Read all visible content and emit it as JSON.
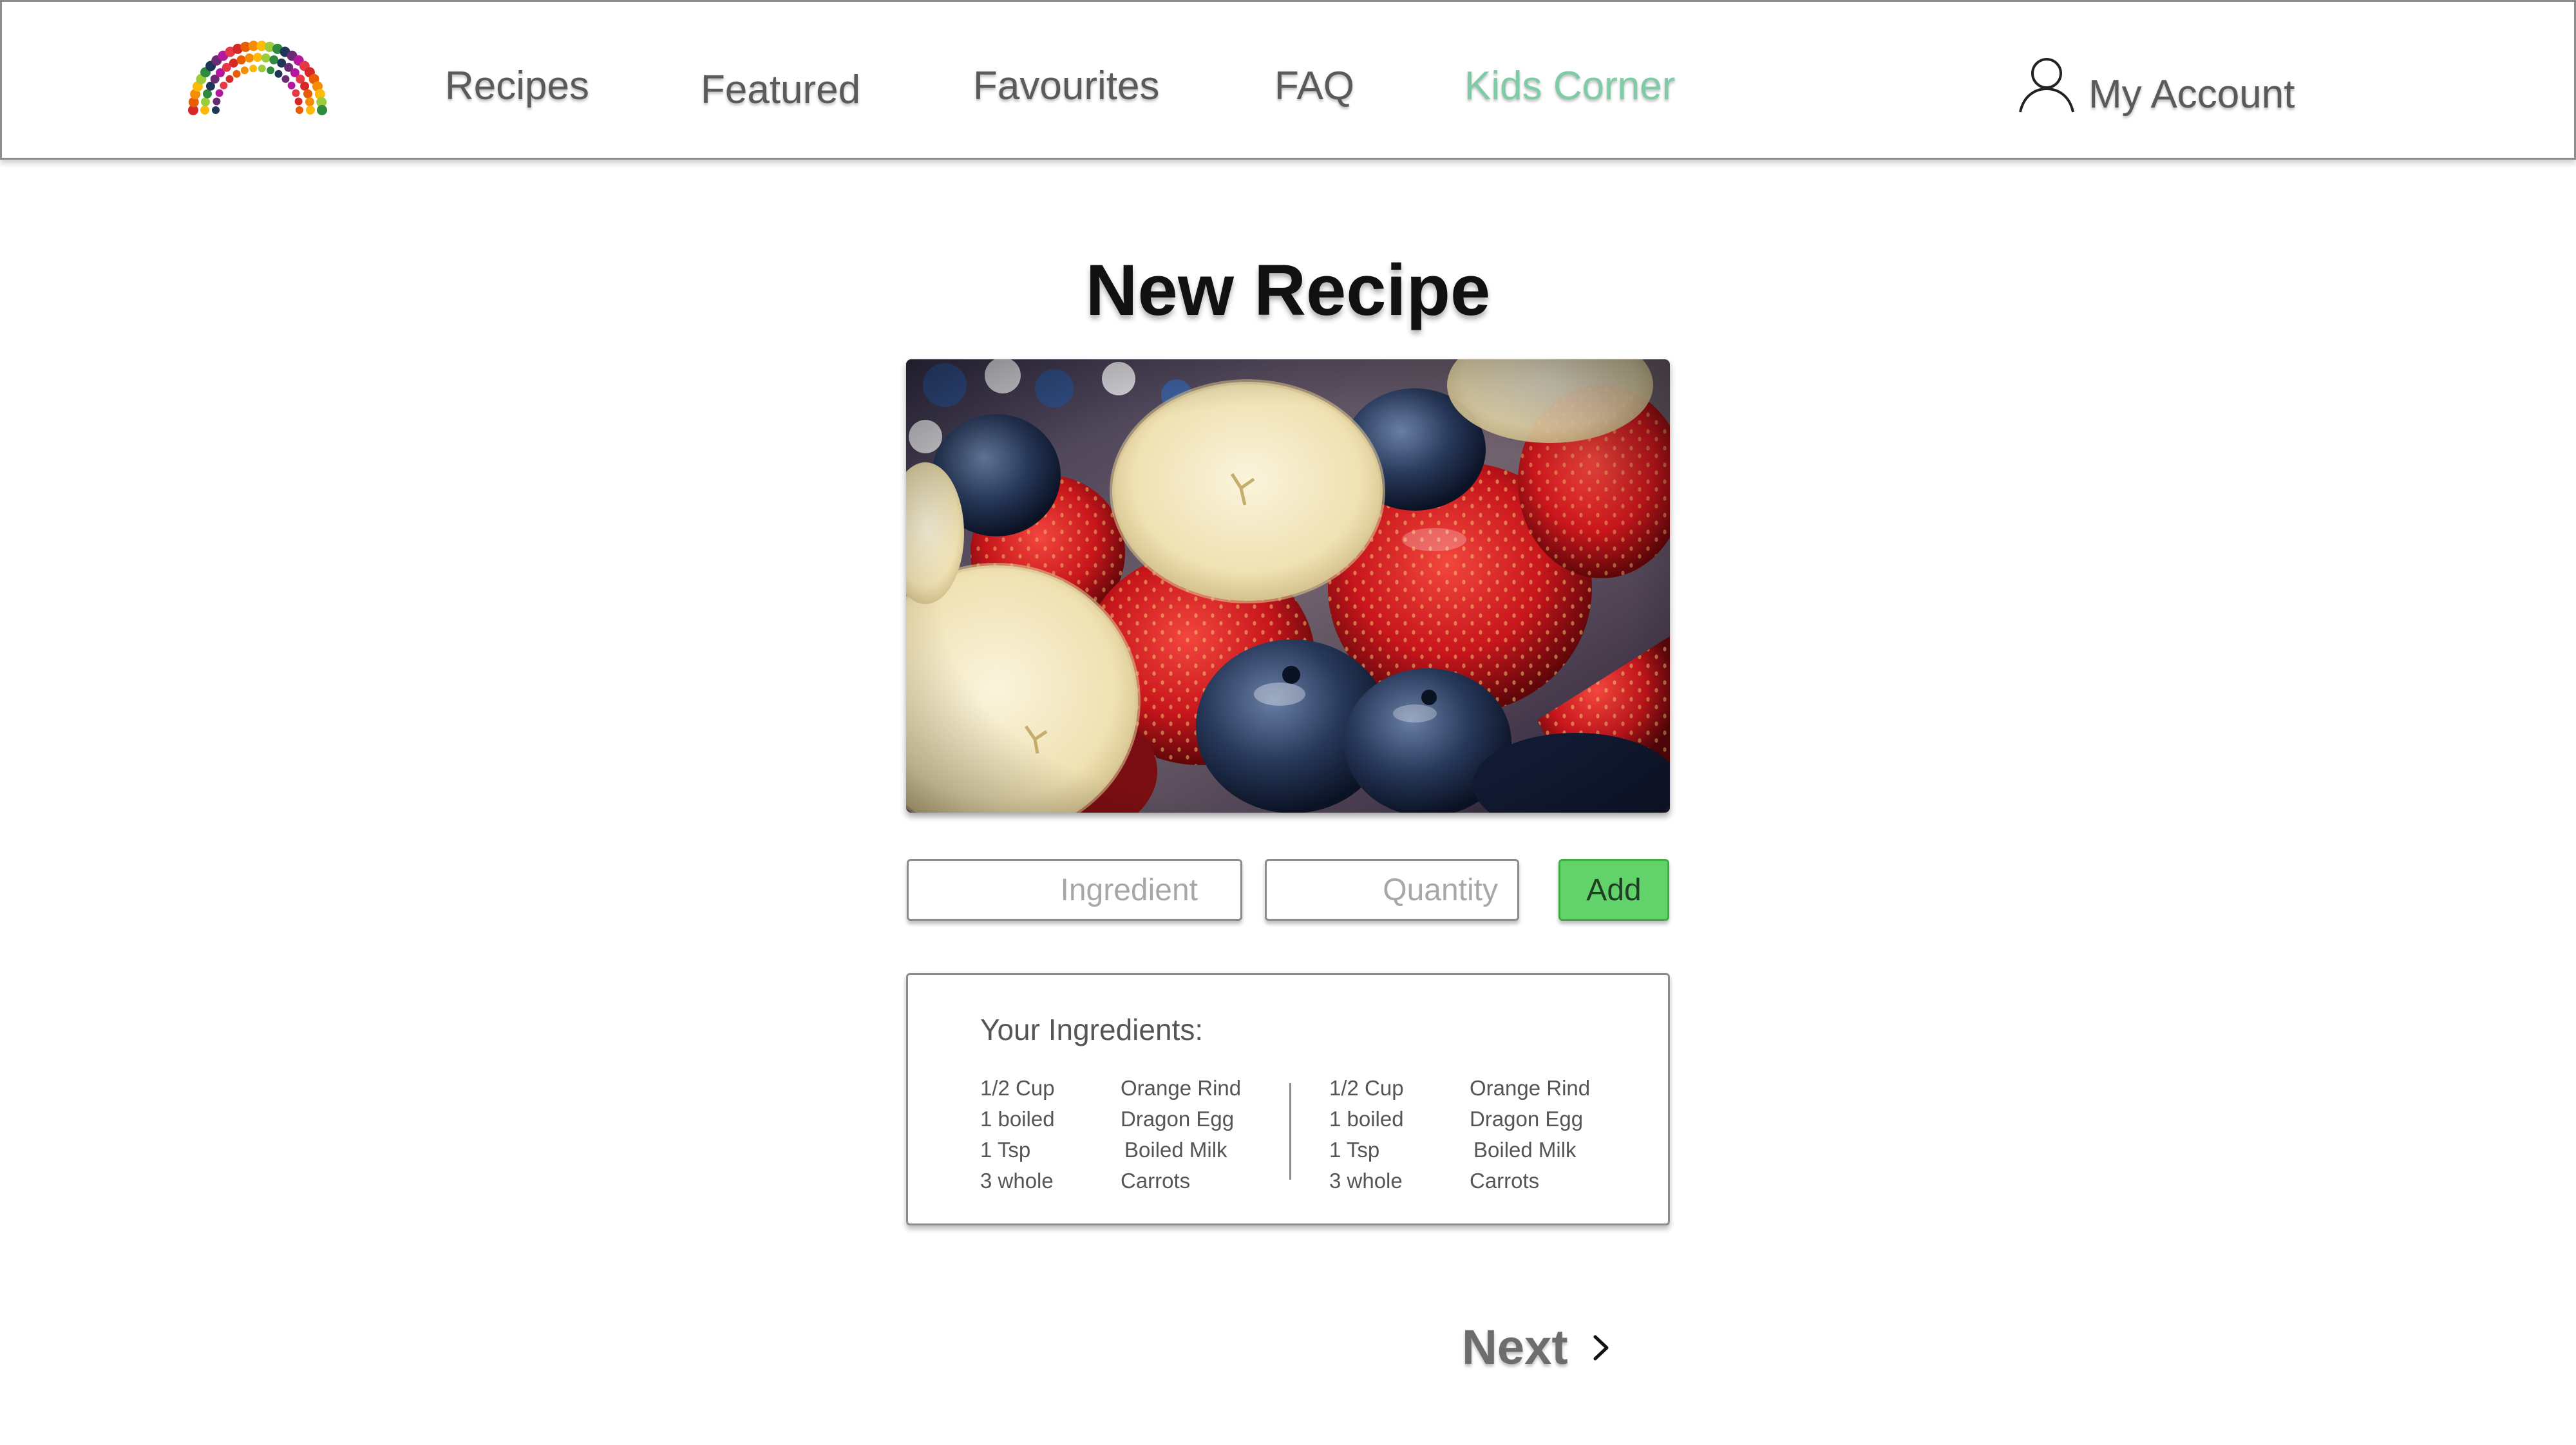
{
  "nav": {
    "links": [
      "Recipes",
      "Featured",
      "Favourites",
      "FAQ",
      "Kids Corner"
    ],
    "active": "Kids Corner",
    "account_label": "My Account"
  },
  "page": {
    "title": "New Recipe"
  },
  "form": {
    "ingredient_placeholder": "Ingredient",
    "quantity_placeholder": "Quantity",
    "add_label": "Add"
  },
  "ingredients": {
    "heading": "Your Ingredients:",
    "left": {
      "quantities": [
        "1/2 Cup",
        "1 boiled",
        "1 Tsp",
        "3 whole"
      ],
      "items": [
        "Orange Rind",
        "Dragon Egg",
        "Boiled Milk",
        "Carrots"
      ]
    },
    "right": {
      "quantities": [
        "1/2 Cup",
        "1 boiled",
        "1 Tsp",
        "3 whole"
      ],
      "items": [
        "Orange Rind",
        "Dragon Egg",
        "Boiled Milk",
        "Carrots"
      ]
    }
  },
  "footer": {
    "next_label": "Next"
  },
  "icons": {
    "logo": "fruit-rainbow-logo-icon",
    "account": "user-icon",
    "next": "chevron-right-icon"
  },
  "colors": {
    "active_nav": "#7fcba7",
    "add_button": "#62d36a",
    "text_gray": "#5a5a5a"
  }
}
